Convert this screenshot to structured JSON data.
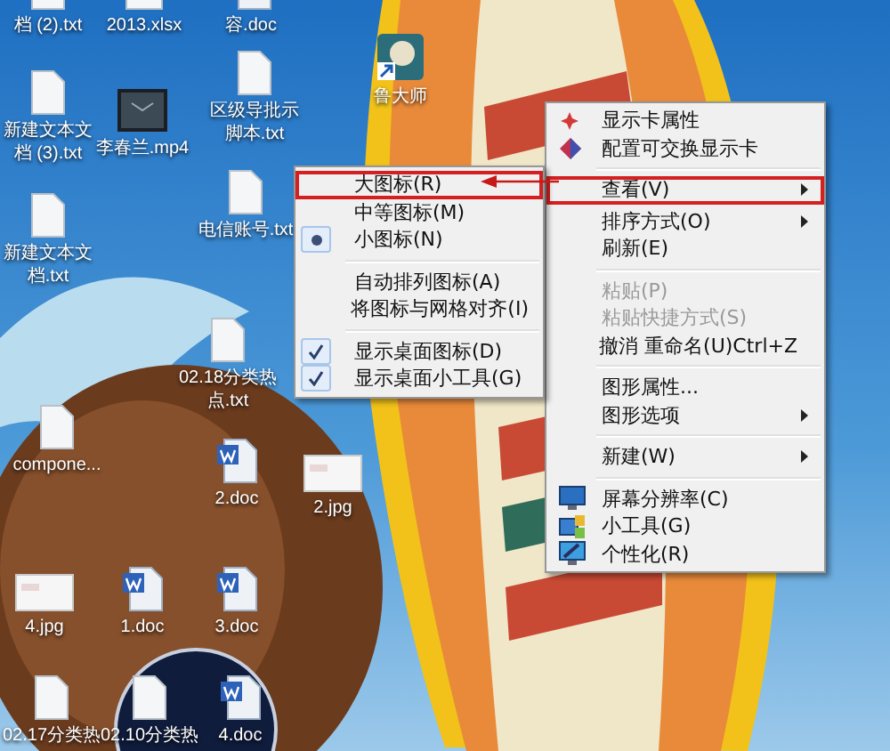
{
  "desktop_icons": [
    {
      "kind": "txt",
      "label": "档 (2).txt"
    },
    {
      "kind": "xlsx",
      "label": "2013.xlsx"
    },
    {
      "kind": "doc",
      "label": "容.doc"
    },
    {
      "kind": "shortcut",
      "label": "鲁大师"
    },
    {
      "kind": "txt",
      "label": "新建文本文档 (3).txt"
    },
    {
      "kind": "video",
      "label": "李春兰.mp4"
    },
    {
      "kind": "txt",
      "label": "区级导批示脚本.txt"
    },
    {
      "kind": "txt",
      "label": "电信账号.txt"
    },
    {
      "kind": "txt",
      "label": "新建文本文档.txt"
    },
    {
      "kind": "txt",
      "label": "02.18分类热点.txt"
    },
    {
      "kind": "txt",
      "label": "compone..."
    },
    {
      "kind": "doc",
      "label": "2.doc"
    },
    {
      "kind": "image",
      "label": "2.jpg"
    },
    {
      "kind": "image",
      "label": "4.jpg"
    },
    {
      "kind": "doc",
      "label": "1.doc"
    },
    {
      "kind": "doc",
      "label": "3.doc"
    },
    {
      "kind": "txt",
      "label": "02.17分类热"
    },
    {
      "kind": "txt",
      "label": "02.10分类热"
    },
    {
      "kind": "doc",
      "label": "4.doc"
    }
  ],
  "context_menu": {
    "groups": [
      [
        {
          "label": "显示卡属性"
        },
        {
          "label": "配置可交换显示卡"
        }
      ],
      [
        {
          "label": "查看(V)",
          "submenu": true,
          "annotated": true
        },
        {
          "label": "排序方式(O)",
          "submenu": true
        },
        {
          "label": "刷新(E)"
        }
      ],
      [
        {
          "label": "粘贴(P)",
          "disabled": true
        },
        {
          "label": "粘贴快捷方式(S)",
          "disabled": true
        },
        {
          "label": "撤消 重命名(U)",
          "shortcut": "Ctrl+Z"
        }
      ],
      [
        {
          "label": "图形属性..."
        },
        {
          "label": "图形选项",
          "submenu": true
        }
      ],
      [
        {
          "label": "新建(W)",
          "submenu": true
        }
      ],
      [
        {
          "label": "屏幕分辨率(C)"
        },
        {
          "label": "小工具(G)"
        },
        {
          "label": "个性化(R)"
        }
      ]
    ]
  },
  "view_submenu": {
    "groups": [
      [
        {
          "kind": "radio",
          "label": "大图标(R)",
          "selected": false,
          "annotated": true
        },
        {
          "kind": "radio",
          "label": "中等图标(M)",
          "selected": false
        },
        {
          "kind": "radio",
          "label": "小图标(N)",
          "selected": true
        }
      ],
      [
        {
          "kind": "check",
          "label": "自动排列图标(A)",
          "checked": false
        },
        {
          "kind": "check",
          "label": "将图标与网格对齐(I)",
          "checked": false
        }
      ],
      [
        {
          "kind": "check",
          "label": "显示桌面图标(D)",
          "checked": true
        },
        {
          "kind": "check",
          "label": "显示桌面小工具(G)",
          "checked": true
        }
      ]
    ]
  }
}
